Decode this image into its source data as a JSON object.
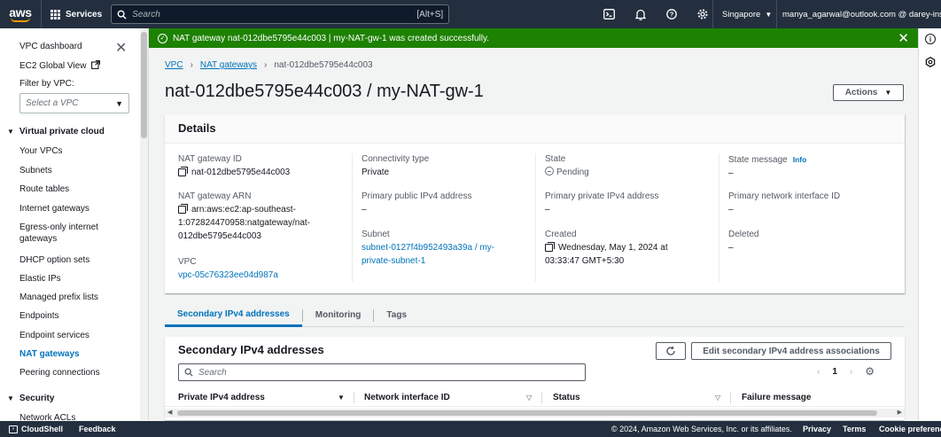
{
  "topnav": {
    "logo": "aws",
    "services_label": "Services",
    "search_placeholder": "Search",
    "search_shortcut": "[Alt+S]",
    "icons": [
      "cloudshell-icon",
      "bell-icon",
      "help-icon",
      "gear-icon"
    ],
    "region": "Singapore",
    "account": "manya_agarwal@outlook.com @ darey-ins"
  },
  "sidebar": {
    "dashboard": "VPC dashboard",
    "ec2_global_view": "EC2 Global View",
    "filter_label": "Filter by VPC:",
    "filter_placeholder": "Select a VPC",
    "section_vpc": "Virtual private cloud",
    "items": [
      "Your VPCs",
      "Subnets",
      "Route tables",
      "Internet gateways",
      "Egress-only internet gateways",
      "DHCP option sets",
      "Elastic IPs",
      "Managed prefix lists",
      "Endpoints",
      "Endpoint services",
      "NAT gateways",
      "Peering connections"
    ],
    "active_item": "NAT gateways",
    "section_security": "Security",
    "security_items": [
      "Network ACLs"
    ]
  },
  "flash": {
    "message": "NAT gateway nat-012dbe5795e44c003 | my-NAT-gw-1 was created successfully."
  },
  "breadcrumb": {
    "root": "VPC",
    "parent": "NAT gateways",
    "current": "nat-012dbe5795e44c003"
  },
  "page": {
    "title": "nat-012dbe5795e44c003 / my-NAT-gw-1",
    "actions_label": "Actions"
  },
  "details": {
    "heading": "Details",
    "nat_gateway_id_label": "NAT gateway ID",
    "nat_gateway_id": "nat-012dbe5795e44c003",
    "nat_gateway_arn_label": "NAT gateway ARN",
    "nat_gateway_arn_lines": [
      "arn:aws:ec2:ap-southeast-",
      "1:072824470958:natgateway/nat-",
      "012dbe5795e44c003"
    ],
    "vpc_label": "VPC",
    "vpc": "vpc-05c76323ee04d987a",
    "connectivity_label": "Connectivity type",
    "connectivity": "Private",
    "public_ip_label": "Primary public IPv4 address",
    "public_ip": "–",
    "subnet_label": "Subnet",
    "subnet_lines": [
      "subnet-0127f4b952493a39a / my-",
      "private-subnet-1"
    ],
    "state_label": "State",
    "state": "Pending",
    "private_ip_label": "Primary private IPv4 address",
    "private_ip": "–",
    "created_label": "Created",
    "created_lines": [
      "Wednesday, May 1, 2024 at",
      "03:33:47 GMT+5:30"
    ],
    "state_message_label": "State message",
    "info_label": "Info",
    "state_message": "–",
    "eni_label": "Primary network interface ID",
    "eni": "–",
    "deleted_label": "Deleted",
    "deleted": "–"
  },
  "tabs": [
    "Secondary IPv4 addresses",
    "Monitoring",
    "Tags"
  ],
  "secondary": {
    "title": "Secondary IPv4 addresses",
    "edit_label": "Edit secondary IPv4 address associations",
    "search_placeholder": "Search",
    "page": "1",
    "columns": [
      "Private IPv4 address",
      "Network interface ID",
      "Status",
      "Failure message"
    ]
  },
  "footer": {
    "cloudshell": "CloudShell",
    "feedback": "Feedback",
    "copyright": "© 2024, Amazon Web Services, Inc. or its affiliates.",
    "privacy": "Privacy",
    "terms": "Terms",
    "cookies": "Cookie preferences"
  },
  "colors": {
    "nav_bg": "#232f3e",
    "flash_green": "#1d8102",
    "link_blue": "#0073bb",
    "aws_orange": "#ff9900"
  }
}
